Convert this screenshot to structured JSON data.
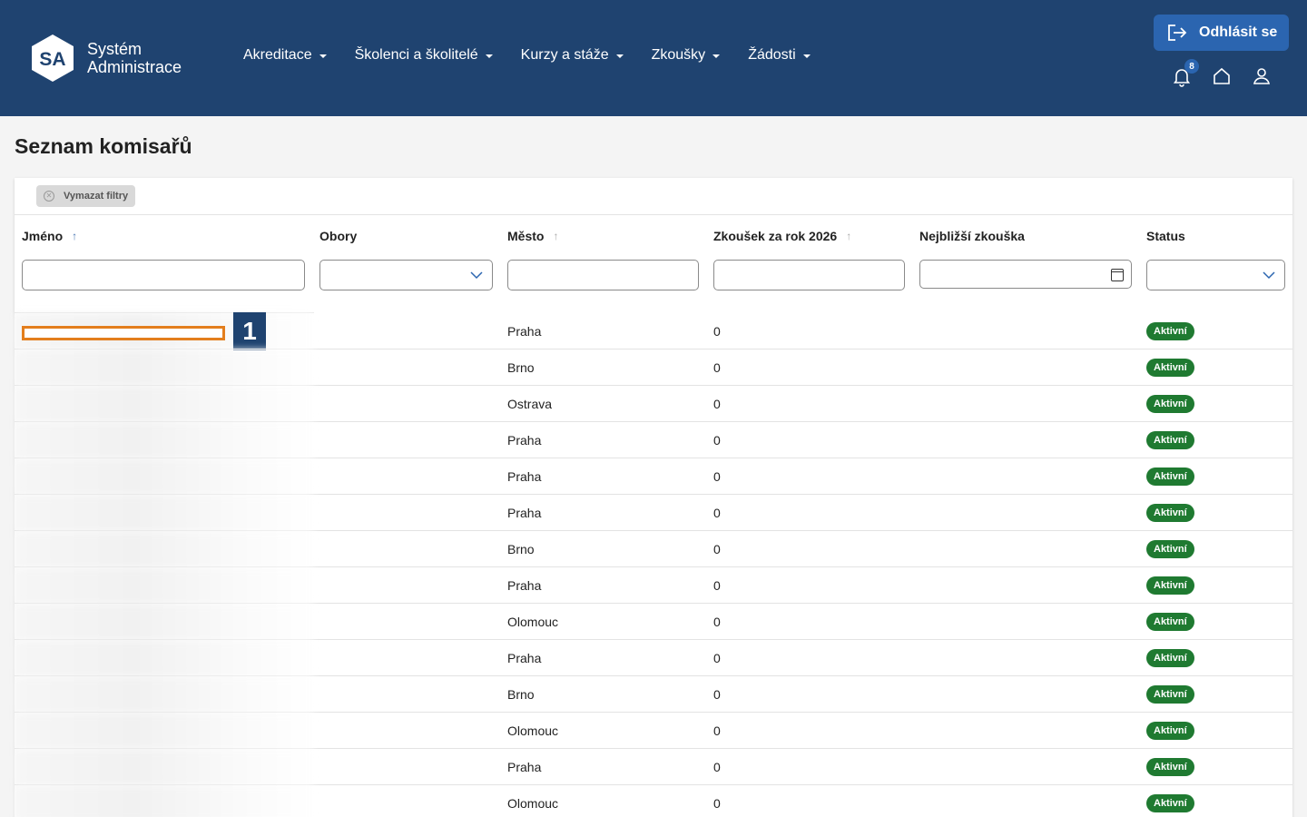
{
  "header": {
    "logo_text": "SA",
    "brand_line1": "Systém",
    "brand_line2": "Administrace",
    "nav": [
      {
        "label": "Akreditace"
      },
      {
        "label": "Školenci a školitelé"
      },
      {
        "label": "Kurzy a stáže"
      },
      {
        "label": "Zkoušky"
      },
      {
        "label": "Žádosti"
      }
    ],
    "logout_label": "Odhlásit se",
    "notification_count": "8",
    "icons": [
      "logout-icon",
      "bell-icon",
      "home-icon",
      "user-icon"
    ]
  },
  "page": {
    "title": "Seznam komisařů"
  },
  "filters": {
    "clear_label": "Vymazat filtry"
  },
  "table": {
    "columns": [
      {
        "label": "Jméno",
        "sort": "↑"
      },
      {
        "label": "Obory"
      },
      {
        "label": "Město",
        "sort": "↑"
      },
      {
        "label": "Zkoušek za rok 2026",
        "sort": "↑"
      },
      {
        "label": "Nejbližší zkouška"
      },
      {
        "label": "Status"
      }
    ],
    "rows": [
      {
        "mesto": "Praha",
        "zkousek": "0",
        "status": "Aktivní"
      },
      {
        "mesto": "Brno",
        "zkousek": "0",
        "status": "Aktivní"
      },
      {
        "mesto": "Ostrava",
        "zkousek": "0",
        "status": "Aktivní"
      },
      {
        "mesto": "Praha",
        "zkousek": "0",
        "status": "Aktivní"
      },
      {
        "mesto": "Praha",
        "zkousek": "0",
        "status": "Aktivní"
      },
      {
        "mesto": "Praha",
        "zkousek": "0",
        "status": "Aktivní"
      },
      {
        "mesto": "Brno",
        "zkousek": "0",
        "status": "Aktivní"
      },
      {
        "mesto": "Praha",
        "zkousek": "0",
        "status": "Aktivní"
      },
      {
        "mesto": "Olomouc",
        "zkousek": "0",
        "status": "Aktivní"
      },
      {
        "mesto": "Praha",
        "zkousek": "0",
        "status": "Aktivní"
      },
      {
        "mesto": "Brno",
        "zkousek": "0",
        "status": "Aktivní"
      },
      {
        "mesto": "Olomouc",
        "zkousek": "0",
        "status": "Aktivní"
      },
      {
        "mesto": "Praha",
        "zkousek": "0",
        "status": "Aktivní"
      },
      {
        "mesto": "Olomouc",
        "zkousek": "0",
        "status": "Aktivní"
      }
    ]
  },
  "annotation": {
    "marker_label": "1"
  },
  "colors": {
    "header_bg": "#1f4370",
    "accent": "#2b65b0",
    "status_active": "#1f7a31",
    "highlight": "#e37e1d"
  }
}
